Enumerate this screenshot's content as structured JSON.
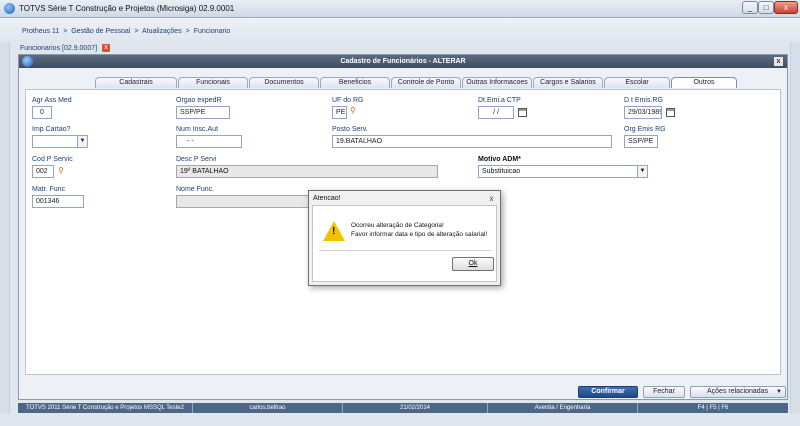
{
  "window": {
    "title": "TOTVS Série T Construção e Projetos (Microsiga) 02.9.0001",
    "minimize": "_",
    "maximize": "□",
    "close": "x"
  },
  "breadcrumb": [
    "Protheus 11",
    ">",
    "Gestão de Pessoal",
    ">",
    "Atualizações",
    ">",
    "Funcionario"
  ],
  "doc_tab": {
    "label": "Funcionarios [02.9.0007]",
    "close": "x"
  },
  "panel": {
    "title": "Cadastro de Funcionários - ALTERAR",
    "close": "x"
  },
  "tabs": [
    "Cadastrais",
    "Funcionais",
    "Documentos",
    "Beneficios",
    "Controle de Ponto",
    "Outras Informacoes",
    "Cargos e Salarios",
    "Escolar",
    "Outros"
  ],
  "active_tab": "Outros",
  "fields": {
    "agr_ass_med": {
      "label": "Agr Ass Med",
      "value": "0"
    },
    "orgao_exped": {
      "label": "Orgao expedR",
      "value": "SSP/PE"
    },
    "uf_rg": {
      "label": "UF do RG",
      "value": "PE"
    },
    "dt_emi_ctp": {
      "label": "Dt.Emi.a CTP",
      "value": "/  /"
    },
    "dt_emis_rg": {
      "label": "D t Emis.RG",
      "value": "29/03/1989"
    },
    "imp_cartao": {
      "label": "Imp Cartao?",
      "value": ""
    },
    "num_insc_aut": {
      "label": "Num Insc.Aut",
      "value": "-   -"
    },
    "posto_serv": {
      "label": "Posto Serv.",
      "value": "19.BATALHAO"
    },
    "org_emis_rg": {
      "label": "Org Emis RG",
      "value": "SSP/PE"
    },
    "cod_p_servic": {
      "label": "Cod P Servic",
      "value": "002"
    },
    "desc_p_servi": {
      "label": "Desc P Servi",
      "value": "19º BATALHAO"
    },
    "motivo_adm": {
      "label": "Motivo ADM*",
      "value": "Substituicao"
    },
    "matr_func": {
      "label": "Matr. Func",
      "value": "001346"
    },
    "nome_func": {
      "label": "Nome Func.",
      "value": ""
    }
  },
  "dialog": {
    "title": "Atencao!",
    "close": "x",
    "line1": "Ocorreu alteração de Categoria!",
    "line2": "Favor informar data e tipo de alteração salarial!",
    "ok_label": "Ok",
    "icon": "warning-icon"
  },
  "buttons": {
    "confirm": "Confirmar",
    "close": "Fechar",
    "actions": "Ações relacionadas"
  },
  "statusbar": [
    "TOTVS 2011 Série T Construção e Projetos MSSQL Teste2",
    "carlos.beltrao",
    "21/02/2014",
    "Aventia / Engenharia",
    "F4 | F5 | F6"
  ],
  "colors": {
    "accent": "#1e4a89",
    "warning": "#f2c100",
    "panel_header": "#3f4c5f"
  }
}
